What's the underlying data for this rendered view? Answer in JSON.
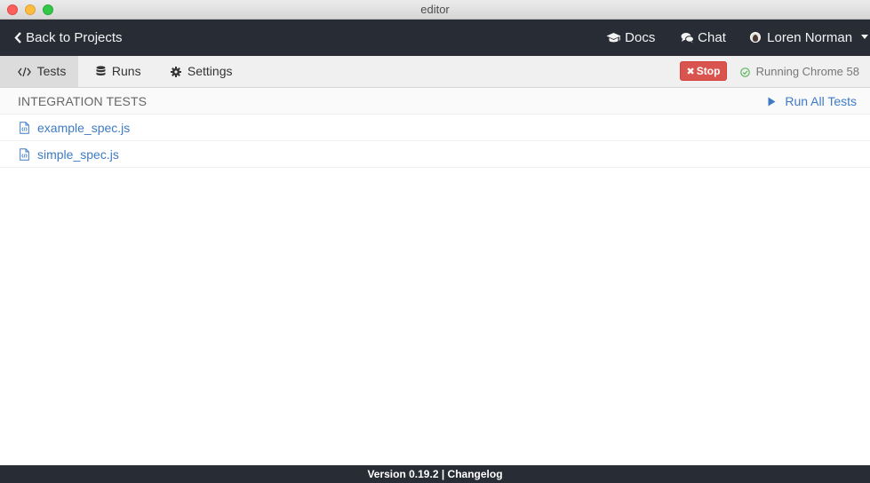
{
  "window": {
    "title": "editor"
  },
  "topnav": {
    "back_label": "Back to Projects",
    "docs_label": "Docs",
    "chat_label": "Chat",
    "user_name": "Loren Norman"
  },
  "tabs": [
    {
      "label": "Tests",
      "icon": "code-icon",
      "active": true
    },
    {
      "label": "Runs",
      "icon": "database-icon",
      "active": false
    },
    {
      "label": "Settings",
      "icon": "gear-icon",
      "active": false
    }
  ],
  "stop_button": {
    "label": "Stop"
  },
  "browser_status": {
    "text": "Running Chrome 58"
  },
  "tests_section": {
    "title": "INTEGRATION TESTS",
    "run_all_label": "Run All Tests",
    "specs": [
      {
        "name": "example_spec.js"
      },
      {
        "name": "simple_spec.js"
      }
    ]
  },
  "footer": {
    "version": "Version 0.19.2",
    "separator": "|",
    "changelog": "Changelog"
  },
  "colors": {
    "nav_bg": "#282c35",
    "link": "#3e7bc4",
    "stop": "#d9534f",
    "status_ok": "#5cb85c"
  }
}
